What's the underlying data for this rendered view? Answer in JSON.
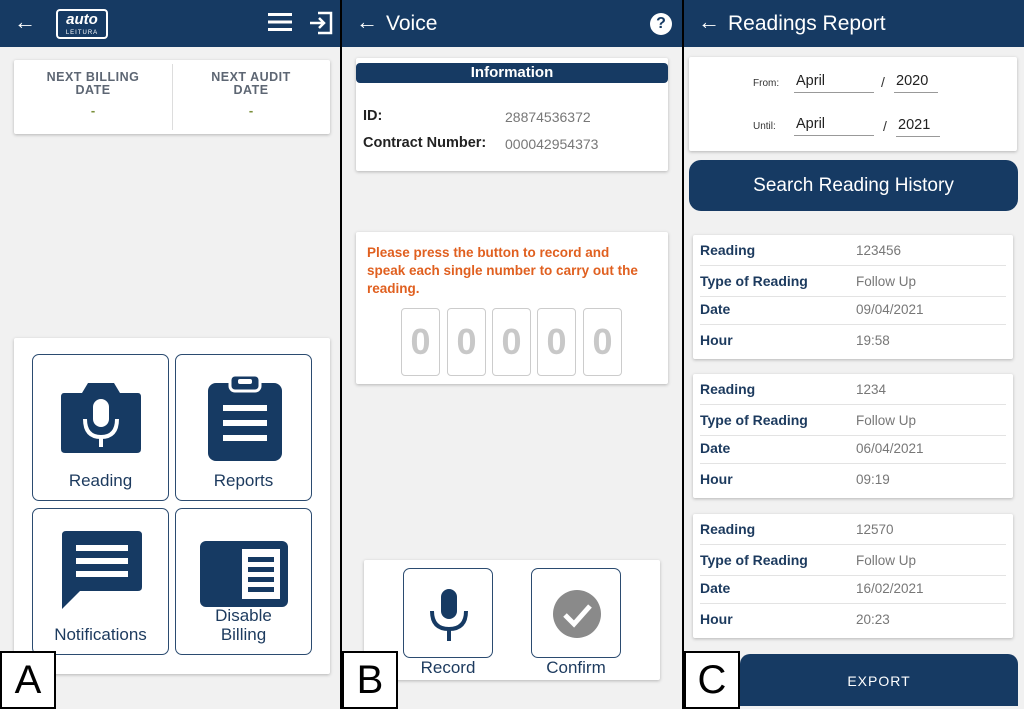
{
  "panels": {
    "a": {
      "label": "A",
      "logo": {
        "main": "auto",
        "sub": "LEITURA"
      },
      "dates": {
        "billing_title": "NEXT BILLING DATE",
        "billing_value": "-",
        "audit_title": "NEXT AUDIT DATE",
        "audit_value": "-"
      },
      "menu": {
        "reading": "Reading",
        "reports": "Reports",
        "notifications": "Notifications",
        "disable_billing": "Disable Billing"
      }
    },
    "b": {
      "label": "B",
      "title": "Voice",
      "help": "?",
      "info": {
        "header": "Information",
        "id_label": "ID:",
        "id_value": "28874536372",
        "contract_label": "Contract Number:",
        "contract_value": "000042954373"
      },
      "instruction": "Please press the button to record and speak each single number to carry out the reading.",
      "digits": [
        "0",
        "0",
        "0",
        "0",
        "0"
      ],
      "record_label": "Record",
      "confirm_label": "Confirm"
    },
    "c": {
      "label": "C",
      "title": "Readings Report",
      "from_label": "From:",
      "from_month": "April",
      "from_year": "2020",
      "until_label": "Until:",
      "until_month": "April",
      "until_year": "2021",
      "slash": "/",
      "search_label": "Search Reading History",
      "reports": [
        {
          "reading_label": "Reading",
          "reading": "123456",
          "type_label": "Type of Reading",
          "type": "Follow Up",
          "date_label": "Date",
          "date": "09/04/2021",
          "hour_label": "Hour",
          "hour": "19:58"
        },
        {
          "reading_label": "Reading",
          "reading": "1234",
          "type_label": "Type of Reading",
          "type": "Follow Up",
          "date_label": "Date",
          "date": "06/04/2021",
          "hour_label": "Hour",
          "hour": "09:19"
        },
        {
          "reading_label": "Reading",
          "reading": "12570",
          "type_label": "Type of Reading",
          "type": "Follow Up",
          "date_label": "Date",
          "date": "16/02/2021",
          "hour_label": "Hour",
          "hour": "20:23"
        }
      ],
      "export_label": "EXPORT"
    }
  },
  "colors": {
    "primary": "#163a63",
    "accent": "#e06020",
    "background": "#f1f1f1"
  },
  "icons": {
    "back": "arrow-left-icon",
    "menu": "hamburger-icon",
    "logout": "logout-icon",
    "help": "help-icon",
    "mic": "microphone-icon",
    "check": "check-circle-icon"
  }
}
